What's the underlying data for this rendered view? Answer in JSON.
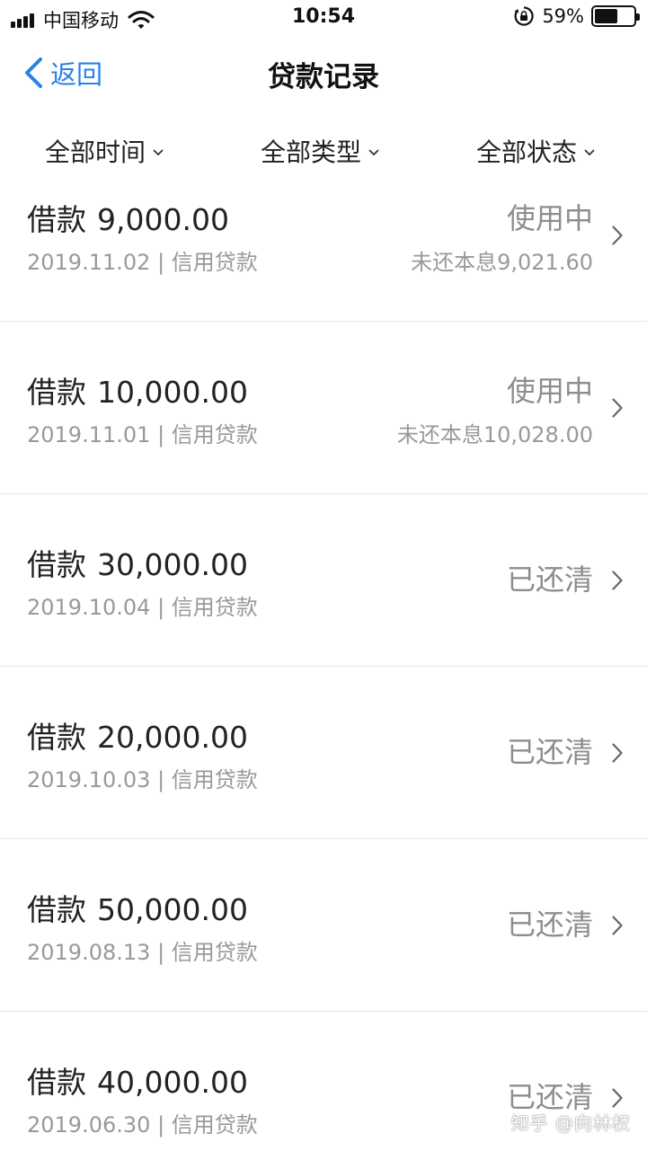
{
  "status_bar": {
    "carrier": "中国移动",
    "time": "10:54",
    "battery_percent": "59%",
    "battery_level": 0.59,
    "icons": [
      "signal-icon",
      "wifi-icon",
      "rotation-lock-icon",
      "battery-icon"
    ]
  },
  "nav": {
    "back_label": "返回",
    "title": "贷款记录"
  },
  "filters": {
    "time": "全部时间",
    "type": "全部类型",
    "status": "全部状态"
  },
  "records": [
    {
      "prefix": "借款",
      "amount": "9,000.00",
      "date": "2019.11.02",
      "separator": "|",
      "category": "信用贷款",
      "status": "使用中",
      "remaining": "未还本息9,021.60"
    },
    {
      "prefix": "借款",
      "amount": "10,000.00",
      "date": "2019.11.01",
      "separator": "|",
      "category": "信用贷款",
      "status": "使用中",
      "remaining": "未还本息10,028.00"
    },
    {
      "prefix": "借款",
      "amount": "30,000.00",
      "date": "2019.10.04",
      "separator": "|",
      "category": "信用贷款",
      "status": "已还清"
    },
    {
      "prefix": "借款",
      "amount": "20,000.00",
      "date": "2019.10.03",
      "separator": "|",
      "category": "信用贷款",
      "status": "已还清"
    },
    {
      "prefix": "借款",
      "amount": "50,000.00",
      "date": "2019.08.13",
      "separator": "|",
      "category": "信用贷款",
      "status": "已还清"
    },
    {
      "prefix": "借款",
      "amount": "40,000.00",
      "date": "2019.06.30",
      "separator": "|",
      "category": "信用贷款",
      "status": "已还清"
    }
  ],
  "watermark": "知乎 @向林权",
  "colors": {
    "accent": "#2a82e4",
    "text_primary": "#222222",
    "text_secondary": "#999999",
    "divider": "#e5e5e5"
  }
}
